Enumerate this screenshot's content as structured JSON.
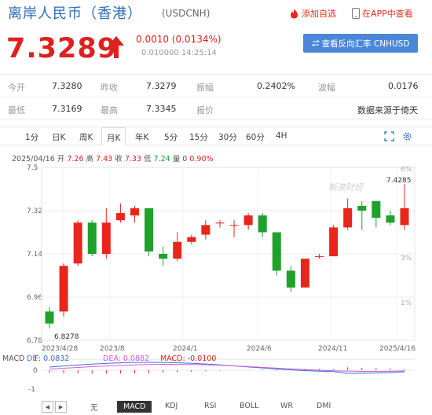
{
  "header": {
    "title": "离岸人民币（香港）",
    "code": "(USDCNH)",
    "add_watch": "添加自选",
    "app_view": "在APP中查看"
  },
  "quote": {
    "price": "7.3289",
    "change": "0.0010 (0.0134%)",
    "sub": "0.010000 14:25:14",
    "reverse_btn": "查看反向汇率 CNHUSD"
  },
  "stats": {
    "open_label": "今开",
    "open": "7.3280",
    "prev_label": "昨收",
    "prev": "7.3279",
    "amp_label": "振幅",
    "amp": "0.2402%",
    "wave_label": "波幅",
    "wave": "0.0176",
    "low_label": "最低",
    "low": "7.3169",
    "high_label": "最高",
    "high": "7.3345",
    "report_label": "报价",
    "source": "数据来源于倚天"
  },
  "tabs": [
    "1分",
    "日K",
    "周K",
    "月K",
    "年K",
    "5分",
    "15分",
    "30分",
    "60分",
    "4H"
  ],
  "active_tab": "月K",
  "ohlc": {
    "date": "2025/04/16",
    "open_label": "开",
    "open": "7.26",
    "high_label": "高",
    "high": "7.43",
    "close_label": "收",
    "close": "7.33",
    "low_label": "低",
    "low": "7.24",
    "vol_label": "量",
    "vol": "0",
    "pct": "0.90%"
  },
  "chart_data": {
    "type": "candlestick",
    "y_ticks": [
      "7.5",
      "7.32",
      "7.14",
      "6.96",
      "6.78"
    ],
    "y_pct_ticks": [
      "6%",
      "3%",
      "1%"
    ],
    "x_labels": [
      "2023/4/28",
      "2023/8",
      "2024/1",
      "2024/6",
      "2024/11",
      "2025/4/16"
    ],
    "ylim": [
      6.78,
      7.5
    ],
    "max_label": "7.4285",
    "min_label": "6.8278",
    "watermark": "新浪财经",
    "candles": [
      {
        "o": 6.9,
        "c": 6.85,
        "h": 6.92,
        "l": 6.83
      },
      {
        "o": 6.9,
        "c": 7.09,
        "h": 7.1,
        "l": 6.88
      },
      {
        "o": 7.1,
        "c": 7.27,
        "h": 7.28,
        "l": 7.09
      },
      {
        "o": 7.27,
        "c": 7.14,
        "h": 7.28,
        "l": 7.13
      },
      {
        "o": 7.14,
        "c": 7.27,
        "h": 7.33,
        "l": 7.12
      },
      {
        "o": 7.28,
        "c": 7.31,
        "h": 7.35,
        "l": 7.27
      },
      {
        "o": 7.3,
        "c": 7.33,
        "h": 7.34,
        "l": 7.27
      },
      {
        "o": 7.33,
        "c": 7.15,
        "h": 7.33,
        "l": 7.13
      },
      {
        "o": 7.14,
        "c": 7.12,
        "h": 7.17,
        "l": 7.09
      },
      {
        "o": 7.12,
        "c": 7.19,
        "h": 7.23,
        "l": 7.11
      },
      {
        "o": 7.19,
        "c": 7.21,
        "h": 7.22,
        "l": 7.18
      },
      {
        "o": 7.22,
        "c": 7.26,
        "h": 7.28,
        "l": 7.2
      },
      {
        "o": 7.27,
        "c": 7.27,
        "h": 7.28,
        "l": 7.25
      },
      {
        "o": 7.26,
        "c": 7.26,
        "h": 7.28,
        "l": 7.21
      },
      {
        "o": 7.26,
        "c": 7.3,
        "h": 7.31,
        "l": 7.24
      },
      {
        "o": 7.3,
        "c": 7.23,
        "h": 7.31,
        "l": 7.21
      },
      {
        "o": 7.23,
        "c": 7.07,
        "h": 7.23,
        "l": 7.05
      },
      {
        "o": 7.07,
        "c": 7.0,
        "h": 7.09,
        "l": 6.98
      },
      {
        "o": 7.0,
        "c": 7.12,
        "h": 7.12,
        "l": 7.0
      },
      {
        "o": 7.13,
        "c": 7.13,
        "h": 7.14,
        "l": 7.12
      },
      {
        "o": 7.13,
        "c": 7.25,
        "h": 7.26,
        "l": 7.13
      },
      {
        "o": 7.25,
        "c": 7.33,
        "h": 7.37,
        "l": 7.24
      },
      {
        "o": 7.34,
        "c": 7.32,
        "h": 7.36,
        "l": 7.24
      },
      {
        "o": 7.36,
        "c": 7.29,
        "h": 7.36,
        "l": 7.25
      },
      {
        "o": 7.3,
        "c": 7.27,
        "h": 7.32,
        "l": 7.26
      },
      {
        "o": 7.26,
        "c": 7.33,
        "h": 7.43,
        "l": 7.24
      }
    ]
  },
  "macd": {
    "label": "MACD",
    "dif": "DIF: 0.0832",
    "dea": "DEA: 0.0882",
    "macd": "MACD: -0.0100",
    "y_ticks": [
      "1",
      "0",
      "-1"
    ]
  },
  "bottom_tabs": [
    "无",
    "MACD",
    "KDJ",
    "RSI",
    "BOLL",
    "WR",
    "DMI"
  ],
  "colors": {
    "up": "#e8261b",
    "down": "#1fa12b",
    "accent": "#4a87d8"
  }
}
